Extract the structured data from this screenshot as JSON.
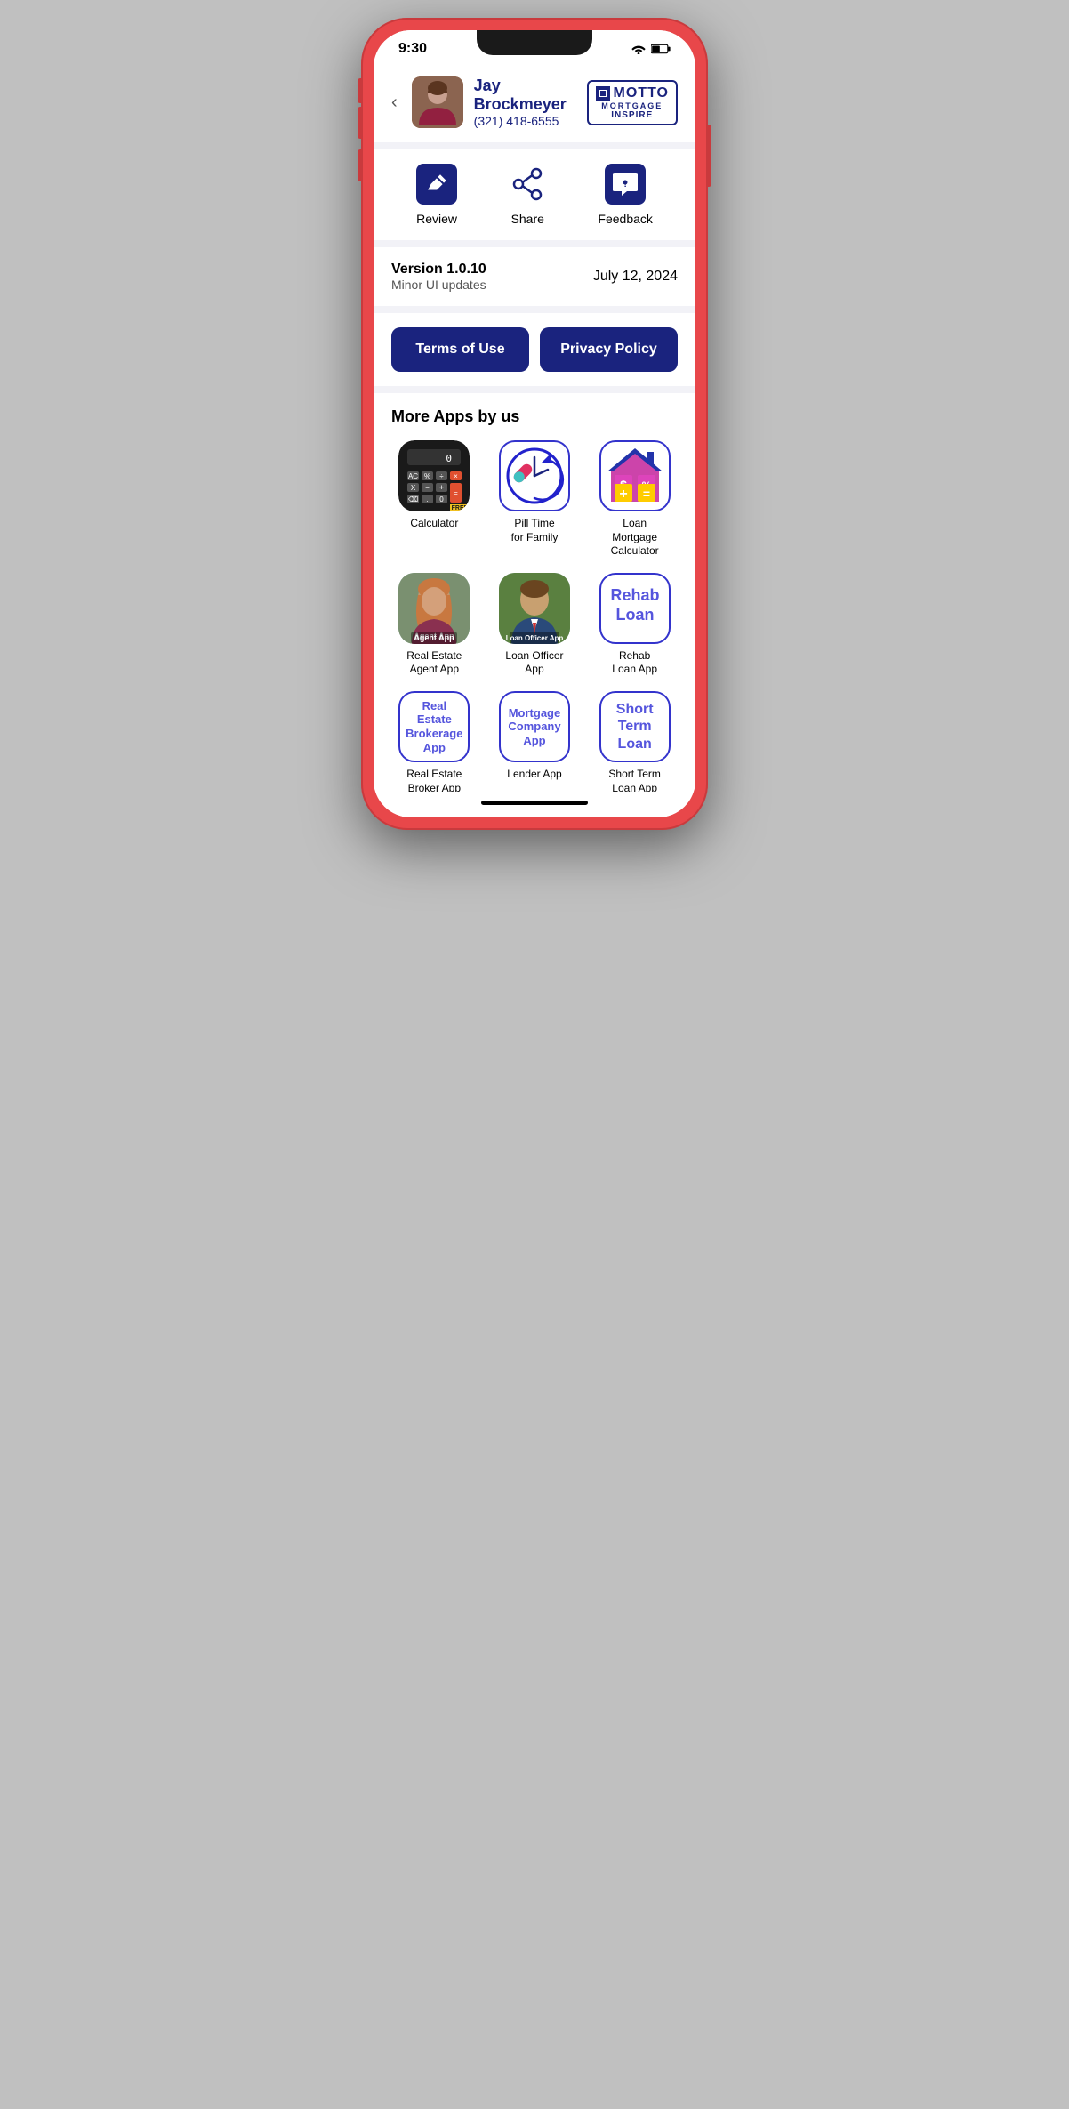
{
  "statusBar": {
    "time": "9:30",
    "wifi": "wifi",
    "battery": "battery"
  },
  "header": {
    "backLabel": "‹",
    "userName": "Jay Brockmeyer",
    "userPhone": "(321) 418-6555",
    "mottoLogo": "MOTTO",
    "mottoMortgage": "MORTGAGE",
    "mottoInspire": "INSPIRE"
  },
  "actions": {
    "review": "Review",
    "share": "Share",
    "feedback": "Feedback"
  },
  "version": {
    "title": "Version 1.0.10",
    "subtitle": "Minor UI updates",
    "date": "July 12, 2024"
  },
  "buttons": {
    "termsOfUse": "Terms of Use",
    "privacyPolicy": "Privacy Policy"
  },
  "moreApps": {
    "sectionTitle": "More Apps by us",
    "apps": [
      {
        "id": "calculator",
        "label": "Calculator",
        "type": "calc"
      },
      {
        "id": "pill-time",
        "label": "Pill Time\nfor Family",
        "type": "pill"
      },
      {
        "id": "loan-mortgage",
        "label": "Loan\nMortgage\nCalculator",
        "type": "loan-house"
      },
      {
        "id": "real-estate-agent",
        "label": "Real Estate\nAgent App",
        "type": "agent"
      },
      {
        "id": "loan-officer",
        "label": "Loan Officer\nApp",
        "type": "loan-officer"
      },
      {
        "id": "rehab-loan",
        "label": "Rehab\nLoan App",
        "type": "rehab"
      },
      {
        "id": "real-estate-broker",
        "label": "Real Estate\nBroker App",
        "type": "text",
        "text": "Real Estate\nBrokerage\nApp"
      },
      {
        "id": "lender-app",
        "label": "Lender App",
        "type": "text",
        "text": "Mortgage\nCompany\nApp"
      },
      {
        "id": "short-term-loan",
        "label": "Short Term\nLoan App",
        "type": "text",
        "text": "Short\nTerm\nLoan"
      }
    ]
  }
}
